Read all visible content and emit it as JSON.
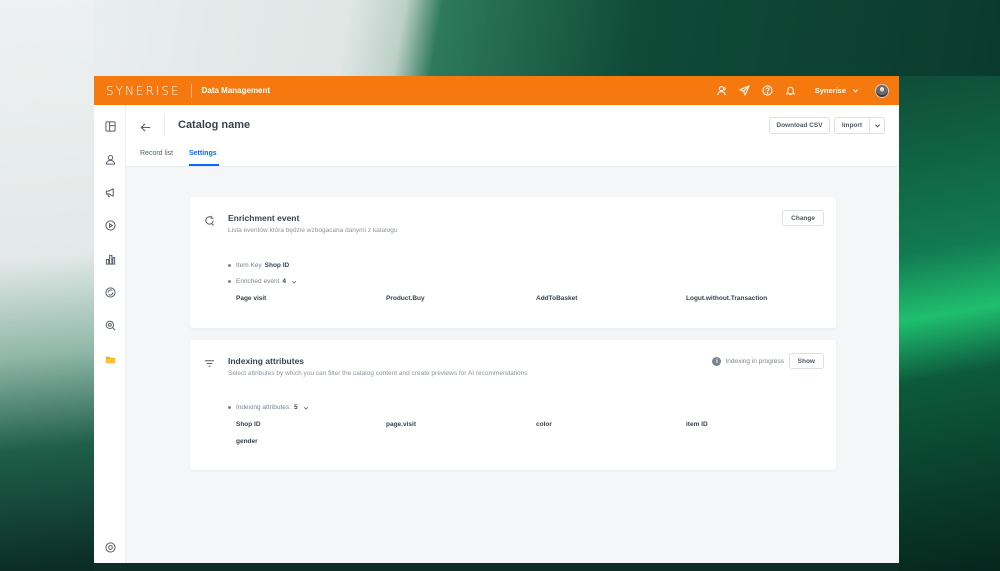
{
  "topbar": {
    "logo": "SYNERISE",
    "app_name": "Data Management",
    "workspace": "Synerise"
  },
  "header": {
    "title": "Catalog name",
    "download_csv": "Download CSV",
    "import": "Import",
    "tabs": [
      {
        "label": "Record list"
      },
      {
        "label": "Settings"
      }
    ]
  },
  "enrichment": {
    "title": "Enrichment event",
    "description": "Lista eventów która będzie wzbogacana danymi z katalogu",
    "change_label": "Change",
    "item_key_label": "Item Key",
    "item_key_value": "Shop ID",
    "enriched_label": "Enriched event",
    "enriched_count": "4",
    "events": [
      "Page visit",
      "Product.Buy",
      "AddToBasket",
      "Logut.without.Transaction"
    ]
  },
  "indexing": {
    "title": "Indexing attributes",
    "description": "Select attributes by which you can filter the catalog content and create previews for AI recommendations",
    "status": "Indexing in progress",
    "show_label": "Show",
    "count_label": "Indexing attributes:",
    "count": "5",
    "attributes": [
      "Shop ID",
      "page.visit",
      "color",
      "item ID",
      "gender"
    ]
  },
  "colors": {
    "brand": "#f5790f",
    "accent": "#0b68ff",
    "text": "#384350"
  },
  "icons": {
    "sidebar": [
      "layout-icon",
      "user-icon",
      "megaphone-icon",
      "play-icon",
      "chart-icon",
      "ai-icon",
      "search-icon",
      "folder-icon",
      "settings-icon"
    ],
    "topbar": [
      "users-icon",
      "send-icon",
      "help-icon",
      "bell-icon"
    ]
  }
}
